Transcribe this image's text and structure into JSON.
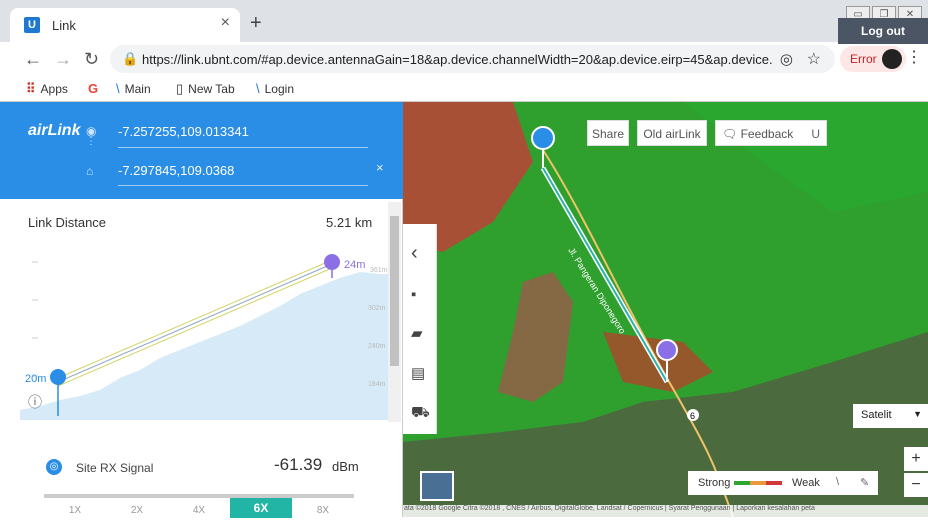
{
  "browser": {
    "tab_title": "Link",
    "tab_icon_letter": "U",
    "close": "×",
    "new_tab": "+",
    "url": "https://link.ubnt.com/#ap.device.antennaGain=18&ap.device.channelWidth=20&ap.device.eirp=45&ap.device...",
    "error_label": "Error",
    "bookmarks": [
      {
        "label": "Apps",
        "icon": "apps-icon"
      },
      {
        "label": "",
        "icon": "google-icon"
      },
      {
        "label": "Main",
        "icon": "rss-icon"
      },
      {
        "label": "New Tab",
        "icon": "page-icon"
      },
      {
        "label": "Login",
        "icon": "rss-icon"
      }
    ]
  },
  "panel": {
    "logo": "airLink",
    "coord_a": "-7.257255,109.013341",
    "coord_b": "-7.297845,109.0368",
    "clear": "×",
    "distance_label": "Link Distance",
    "distance_value": "5.21 km",
    "height_a": "20m",
    "height_b": "24m",
    "elev_ticks": [
      "361m",
      "302m",
      "240m",
      "184m"
    ],
    "signal_label": "Site RX Signal",
    "signal_value": "-61.39",
    "signal_unit": "dBm",
    "zoom_options": [
      "1X",
      "2X",
      "4X",
      "6X",
      "8X"
    ],
    "zoom_selected": "6X",
    "accent": "#2a8ee6"
  },
  "map": {
    "share": "Share",
    "old_airlink": "Old airLink",
    "feedback": "Feedback",
    "logout": "Log out",
    "road_label": "Jl. Pangeran Diponegoro",
    "route_number": "6",
    "map_type": "Satelit",
    "zoom_in": "+",
    "zoom_out": "−",
    "legend_strong": "Strong",
    "legend_weak": "Weak",
    "attribution": "ata ©2018 Google Citra ©2018 , CNES / Airbus, DigitalGlobe, Landsat / Copernicus | Syarat Penggunaan | Laporkan kesalahan peta"
  }
}
